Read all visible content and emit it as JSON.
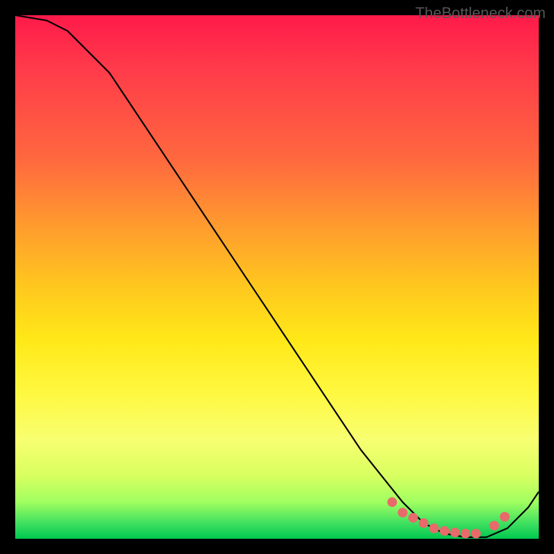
{
  "watermark": "TheBottleneck.com",
  "chart_data": {
    "type": "line",
    "title": "",
    "xlabel": "",
    "ylabel": "",
    "xlim": [
      0,
      100
    ],
    "ylim": [
      0,
      100
    ],
    "x": [
      0,
      6,
      10,
      14,
      18,
      22,
      26,
      30,
      34,
      38,
      42,
      46,
      50,
      54,
      58,
      62,
      66,
      70,
      74,
      78,
      82,
      86,
      90,
      94,
      98,
      100
    ],
    "values": [
      100,
      99,
      97,
      93,
      89,
      83,
      77,
      71,
      65,
      59,
      53,
      47,
      41,
      35,
      29,
      23,
      17,
      12,
      7,
      3,
      1,
      0.3,
      0.3,
      2,
      6,
      9
    ],
    "marker_points": {
      "x": [
        72,
        74,
        76,
        78,
        80,
        82,
        84,
        86,
        88,
        91.5,
        93.5
      ],
      "values": [
        7,
        5,
        4,
        3,
        2,
        1.5,
        1.2,
        1,
        1,
        2.5,
        4.2
      ]
    },
    "colors": {
      "gradient_top": "#ff1a4a",
      "gradient_bottom": "#00c850",
      "curve": "#000000",
      "markers": "#e86a6a",
      "background": "#000000"
    }
  }
}
